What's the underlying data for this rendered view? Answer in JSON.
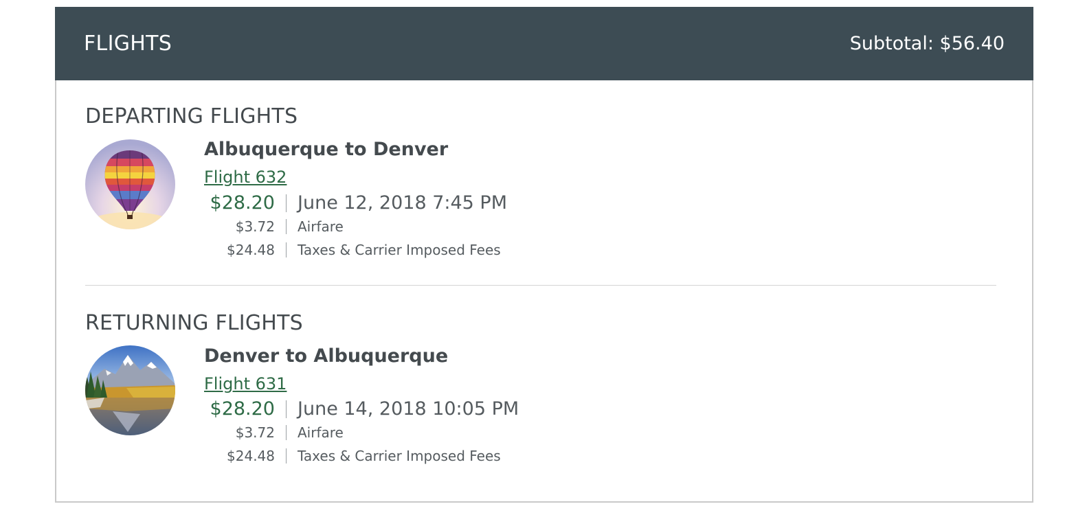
{
  "header": {
    "title": "FLIGHTS",
    "subtotal": "Subtotal: $56.40"
  },
  "departing": {
    "section_title": "DEPARTING FLIGHTS",
    "image_icon": "hot-air-balloon",
    "route": "Albuquerque to Denver",
    "flight_link": "Flight 632",
    "price": "$28.20",
    "datetime": "June 12, 2018 7:45 PM",
    "breakdown": [
      {
        "amount": "$3.72",
        "label": "Airfare"
      },
      {
        "amount": "$24.48",
        "label": "Taxes & Carrier Imposed Fees"
      }
    ]
  },
  "returning": {
    "section_title": "RETURNING FLIGHTS",
    "image_icon": "mountain-lake",
    "route": "Denver to Albuquerque",
    "flight_link": "Flight 631",
    "price": "$28.20",
    "datetime": "June 14, 2018 10:05 PM",
    "breakdown": [
      {
        "amount": "$3.72",
        "label": "Airfare"
      },
      {
        "amount": "$24.48",
        "label": "Taxes & Carrier Imposed Fees"
      }
    ]
  },
  "colors": {
    "header_bg": "#3d4c54",
    "accent_green": "#2e6b46",
    "text_dark": "#444a4e"
  }
}
